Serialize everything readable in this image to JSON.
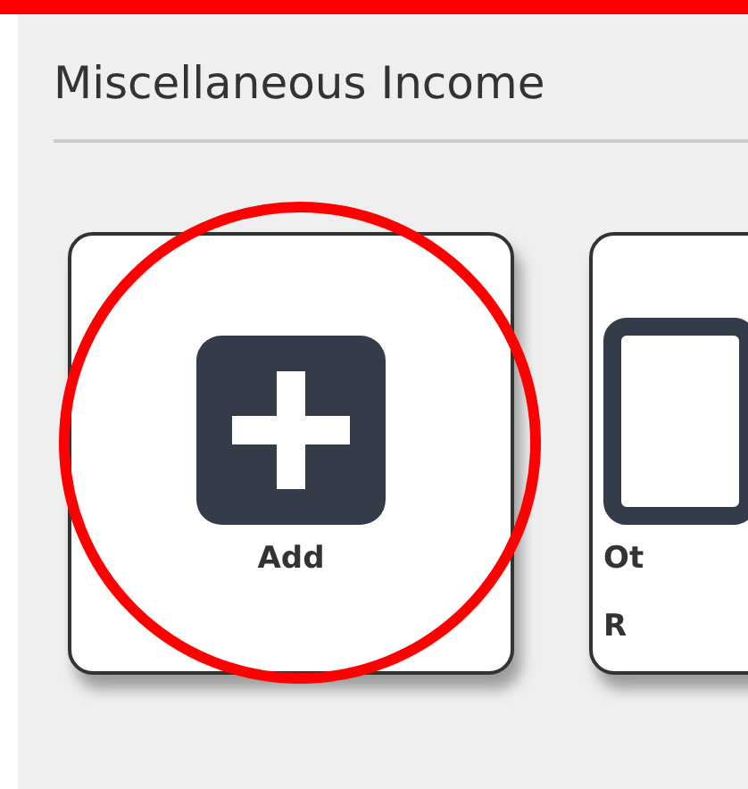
{
  "section": {
    "title": "Miscellaneous Income"
  },
  "tiles": [
    {
      "kind": "plus",
      "label_lines": [
        "Add"
      ],
      "highlighted": true
    },
    {
      "kind": "document",
      "label_lines": [
        "Ot",
        "R"
      ],
      "highlighted": false
    }
  ]
}
